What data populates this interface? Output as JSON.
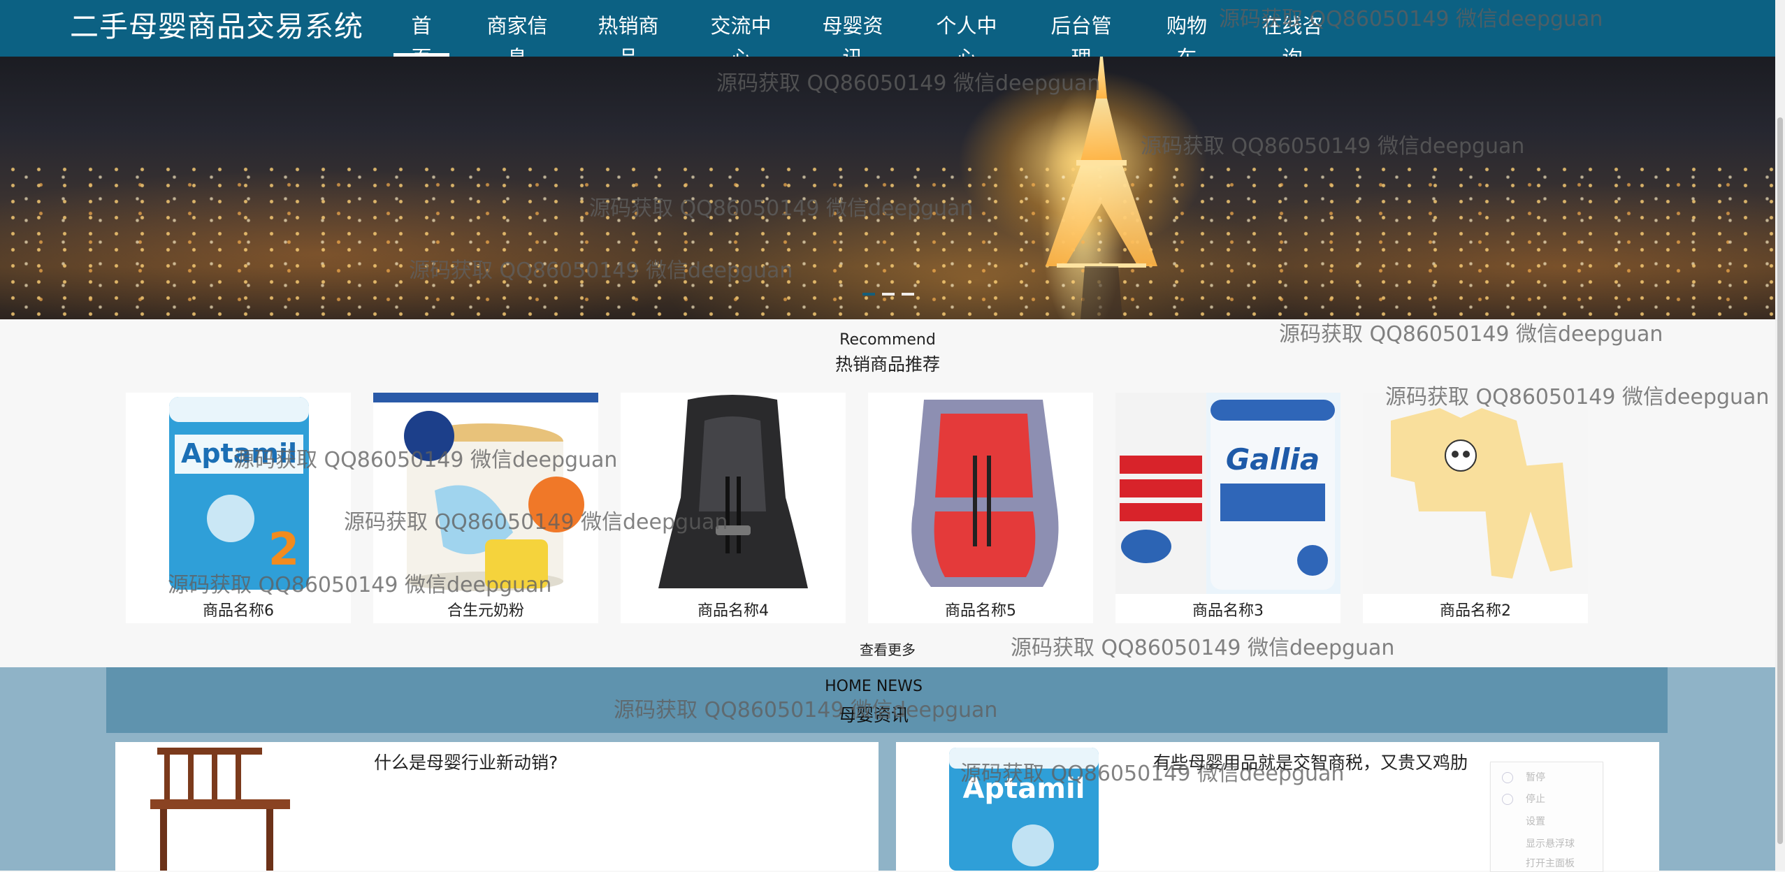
{
  "site": {
    "title": "二手母婴商品交易系统"
  },
  "nav": [
    {
      "label": "首页"
    },
    {
      "label": "商家信息"
    },
    {
      "label": "热销商品"
    },
    {
      "label": "交流中心"
    },
    {
      "label": "母婴资讯"
    },
    {
      "label": "个人中心"
    },
    {
      "label": "后台管理"
    },
    {
      "label": "购物车"
    },
    {
      "label": "在线咨询"
    }
  ],
  "carousel": {
    "slide_count": 3,
    "active_index": 0
  },
  "recommend": {
    "title_en": "Recommend",
    "title_cn": "热销商品推荐",
    "more_label": "查看更多",
    "products": [
      {
        "name": "商品名称6",
        "image": "milk-powder-can-icon"
      },
      {
        "name": "合生元奶粉",
        "image": "milk-powder-can-icon"
      },
      {
        "name": "商品名称4",
        "image": "car-seat-icon"
      },
      {
        "name": "商品名称5",
        "image": "car-seat-icon"
      },
      {
        "name": "商品名称3",
        "image": "milk-powder-can-icon"
      },
      {
        "name": "商品名称2",
        "image": "baby-clothes-icon"
      }
    ]
  },
  "news": {
    "title_en": "HOME NEWS",
    "title_cn": "母婴资讯",
    "items": [
      {
        "title": "什么是母婴行业新动销?",
        "image": "high-chair-icon"
      },
      {
        "title": "有些母婴用品就是交智商税，又贵又鸡肋",
        "image": "milk-powder-can-icon"
      }
    ]
  },
  "context_menu": {
    "items": [
      {
        "label": "暂停"
      },
      {
        "label": "停止"
      },
      {
        "label": "设置"
      },
      {
        "label": "显示悬浮球"
      },
      {
        "label": "打开主面板"
      }
    ]
  },
  "watermark_text": "源码获取 QQ86050149 微信deepguan",
  "colors": {
    "nav_bg": "#0c6183",
    "news_bg": "#8fb3c7",
    "news_band": "#5f93ae"
  }
}
